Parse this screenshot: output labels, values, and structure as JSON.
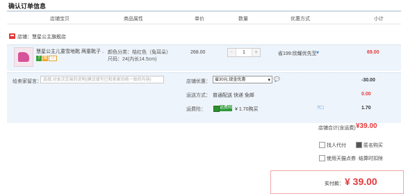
{
  "page_title": "确认订单信息",
  "columns": [
    "店铺宝贝",
    "商品属性",
    "单价",
    "数量",
    "优惠方式",
    "小计"
  ],
  "shop": {
    "label": "店铺：",
    "name": "慧星公主旗舰店"
  },
  "item": {
    "name": "慧星公主儿童雪地靴 两童靴子 ...",
    "badges": [
      "7",
      "赠",
      "▭"
    ],
    "attr_color": "颜色分类：桔红色（兔耳朵）",
    "attr_size": "尺码：24(内长14.5cm)",
    "unit_price": "268.00",
    "quantity": "1",
    "qty_minus": "-",
    "qty_plus": "+",
    "promo": "省199:欣耀优先至",
    "subtotal": "69.00"
  },
  "message": {
    "label": "给卖家留言：",
    "placeholder": "选填:对本次交易的说明(建议填写已和卖家协商一致的内容)"
  },
  "shop_discount": {
    "label": "店铺优惠：",
    "selected": "省30元:现金优惠",
    "amount": "-30.00"
  },
  "shipping": {
    "label": "运送方式：",
    "text": "普通配送 快递 免邮",
    "amount": "0.00"
  },
  "insurance": {
    "label": "运费险：",
    "tag": "运费险",
    "text": "¥ 1.70购买",
    "icons": "?☐",
    "amount": "1.70"
  },
  "shop_total": {
    "label": "店铺合计(含运费)",
    "amount": "¥39.00"
  },
  "options": [
    {
      "label": "找人代付",
      "checked": false
    },
    {
      "label": "匿名购买",
      "checked": true
    },
    {
      "label": "使用天猫点券",
      "checked": false
    },
    {
      "label": "结算时扣除",
      "checked": false
    }
  ],
  "pay": {
    "label": "实付款：",
    "amount": "¥ 39.00"
  },
  "colors": {
    "accent": "#e4393c",
    "panel": "#eef4fb"
  }
}
